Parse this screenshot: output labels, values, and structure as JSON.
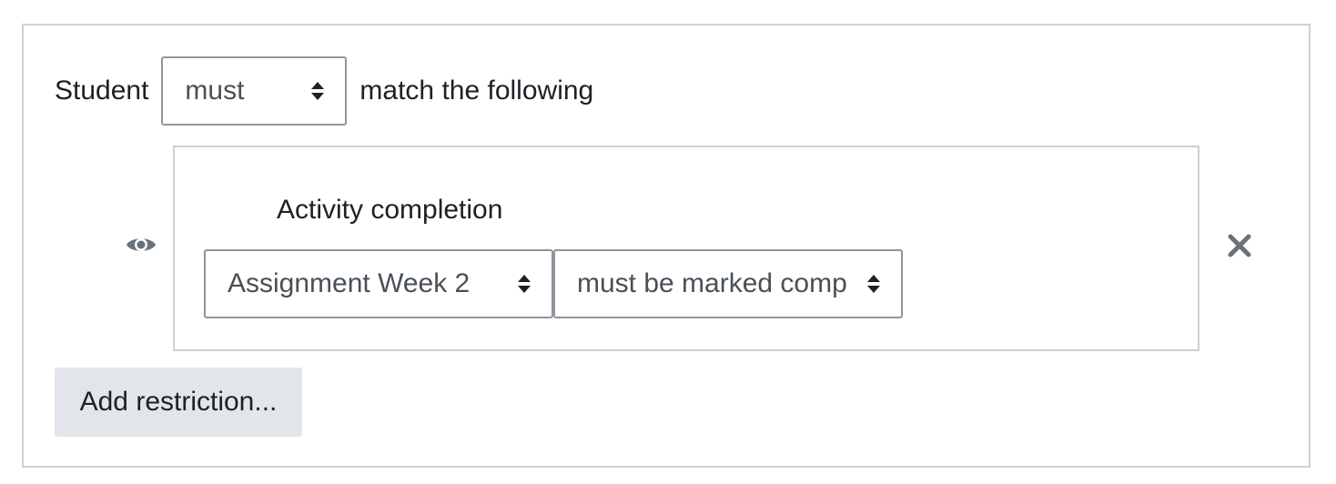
{
  "restriction_set": {
    "prefix_label": "Student",
    "match_select": {
      "value": "must",
      "icon": "sort-arrows-icon"
    },
    "suffix_label": "match the following"
  },
  "condition": {
    "title": "Activity completion",
    "visibility_icon": "eye-icon",
    "activity_select": {
      "value": "Assignment Week 2",
      "icon": "sort-arrows-icon"
    },
    "state_select": {
      "value": "must be marked comp",
      "icon": "sort-arrows-icon"
    },
    "delete_icon": "close-icon"
  },
  "add_restriction_label": "Add restriction...",
  "colors": {
    "border": "#d0d0d0",
    "select_border": "#8f959e",
    "icon": "#6a737b",
    "button_bg": "#e2e5e9",
    "text": "#1d2125"
  }
}
